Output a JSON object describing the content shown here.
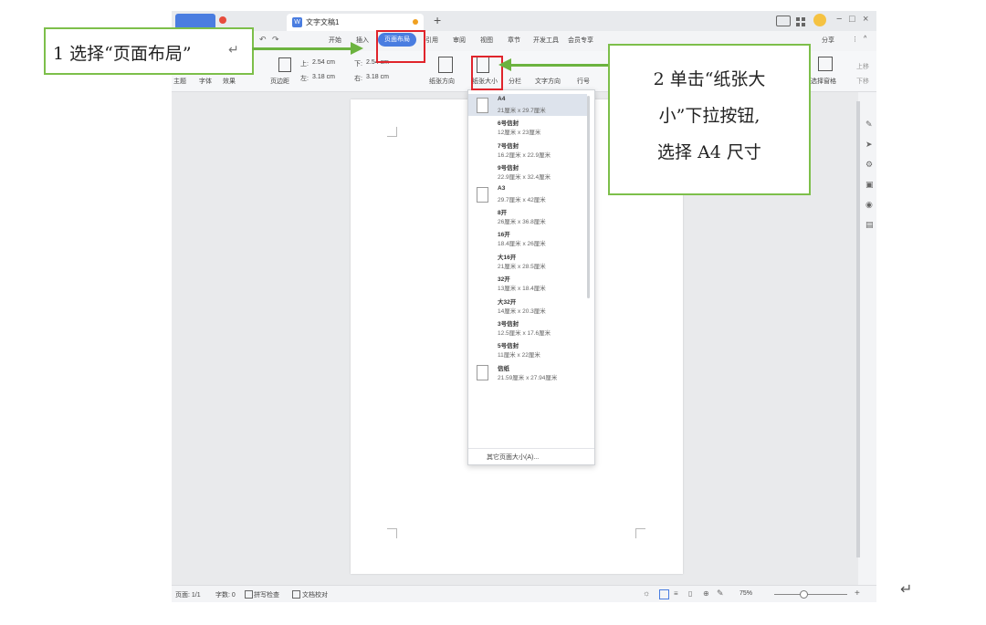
{
  "window": {
    "doc_tab_title": "文字文稿1",
    "doc_tab_icon": "W",
    "new_tab_label": "+",
    "controls": [
      "−",
      "□",
      "×"
    ]
  },
  "menubar": {
    "items": [
      "开始",
      "插入",
      "页面布局",
      "引用",
      "审阅",
      "视图",
      "章节",
      "开发工具",
      "会员专享"
    ],
    "right_items": [
      "分享",
      "⋮",
      "^"
    ],
    "active": "页面布局"
  },
  "ribbon": {
    "theme_label": "主题",
    "font_label": "字体",
    "effect_label": "效果",
    "margins_label": "页边距",
    "margin_top_label": "上:",
    "margin_top_value": "2.54 cm",
    "margin_bottom_label": "下:",
    "margin_bottom_value": "2.54 cm",
    "margin_left_label": "左:",
    "margin_left_value": "3.18 cm",
    "margin_right_label": "右:",
    "margin_right_value": "3.18 cm",
    "orientation_label": "纸张方向",
    "paper_size_label": "纸张大小",
    "columns_label": "分栏",
    "text_direction_label": "文字方向",
    "line_number_label": "行号",
    "select_pane_label": "选择窗格",
    "up_label": "上移",
    "down_label": "下移"
  },
  "paper_menu": {
    "items": [
      {
        "name": "A4",
        "size": "21厘米 x 29.7厘米",
        "selected": true,
        "icon": true
      },
      {
        "name": "6号信封",
        "size": "12厘米 x 23厘米",
        "selected": false,
        "icon": false
      },
      {
        "name": "7号信封",
        "size": "16.2厘米 x 22.9厘米",
        "selected": false,
        "icon": false
      },
      {
        "name": "9号信封",
        "size": "22.9厘米 x 32.4厘米",
        "selected": false,
        "icon": false
      },
      {
        "name": "A3",
        "size": "29.7厘米 x 42厘米",
        "selected": false,
        "icon": true
      },
      {
        "name": "8开",
        "size": "26厘米 x 36.8厘米",
        "selected": false,
        "icon": false
      },
      {
        "name": "16开",
        "size": "18.4厘米 x 26厘米",
        "selected": false,
        "icon": false
      },
      {
        "name": "大16开",
        "size": "21厘米 x 28.5厘米",
        "selected": false,
        "icon": false
      },
      {
        "name": "32开",
        "size": "13厘米 x 18.4厘米",
        "selected": false,
        "icon": false
      },
      {
        "name": "大32开",
        "size": "14厘米 x 20.3厘米",
        "selected": false,
        "icon": false
      },
      {
        "name": "3号信封",
        "size": "12.5厘米 x 17.6厘米",
        "selected": false,
        "icon": false
      },
      {
        "name": "5号信封",
        "size": "11厘米 x 22厘米",
        "selected": false,
        "icon": false
      },
      {
        "name": "信纸",
        "size": "21.59厘米 x 27.94厘米",
        "selected": false,
        "icon": true
      }
    ],
    "other_label": "其它页面大小(A)..."
  },
  "statusbar": {
    "page": "页面: 1/1",
    "words": "字数: 0",
    "spell": "拼写检查",
    "proof": "文档校对",
    "zoom": "75%"
  },
  "callouts": {
    "step1": "1 选择“页面布局”",
    "step2_line1": "2 单击“纸张大",
    "step2_line2": "小”下拉按钮,",
    "step2_line3": "选择 A4 尺寸",
    "return_mark": "↵"
  },
  "colors": {
    "accent": "#4a7de0",
    "callout_border": "#7dbf4a",
    "arrow": "#6cb33f",
    "highlight": "#e0242b"
  }
}
